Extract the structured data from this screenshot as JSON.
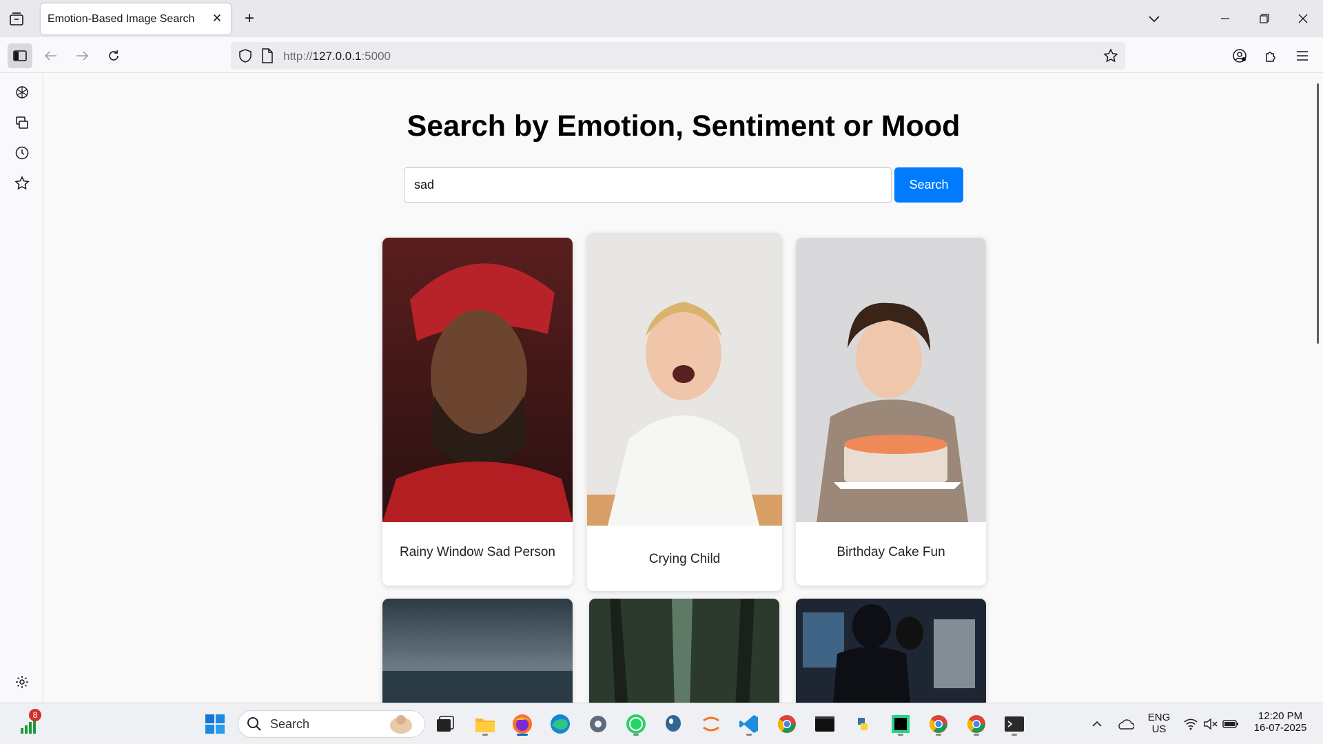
{
  "browser": {
    "tab_title": "Emotion-Based Image Search",
    "url_scheme": "http://",
    "url_host": "127.0.0.1",
    "url_port": ":5000"
  },
  "page": {
    "heading": "Search by Emotion, Sentiment or Mood",
    "search_value": "sad",
    "search_button": "Search",
    "results": [
      {
        "caption": "Rainy Window Sad Person"
      },
      {
        "caption": "Crying Child"
      },
      {
        "caption": "Birthday Cake Fun"
      }
    ]
  },
  "taskbar": {
    "search_label": "Search",
    "notification_count": "8",
    "language": "ENG",
    "region": "US",
    "time": "12:20 PM",
    "date": "16-07-2025"
  },
  "colors": {
    "search_button_bg": "#007bff",
    "page_bg": "#f9f9f9"
  }
}
